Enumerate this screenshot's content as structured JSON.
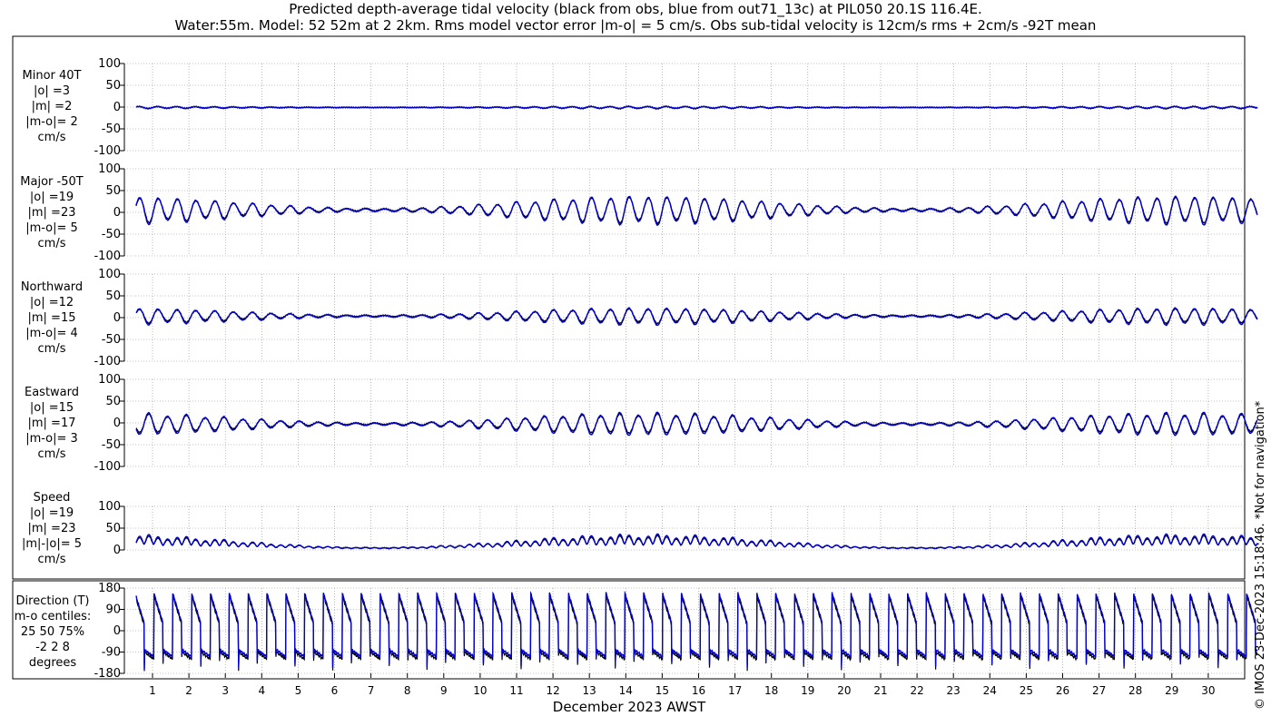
{
  "header": {
    "title_line1": "Predicted depth-average tidal velocity (black from obs, blue from out71_13c) at PIL050 20.1S 116.4E.",
    "title_line2": "Water:55m. Model: 52 52m at 2 2km. Rms model vector error |m-o| = 5 cm/s. Obs sub-tidal velocity is 12cm/s rms + 2cm/s -92T mean"
  },
  "panels": [
    {
      "lines": [
        "Minor 40T",
        "|o| =3",
        "|m| =2",
        "|m-o|= 2",
        "cm/s"
      ]
    },
    {
      "lines": [
        "Major -50T",
        "|o| =19",
        "|m| =23",
        "|m-o|= 5",
        "cm/s"
      ]
    },
    {
      "lines": [
        "Northward",
        "|o| =12",
        "|m| =15",
        "|m-o|= 4",
        "cm/s"
      ]
    },
    {
      "lines": [
        "Eastward",
        "|o| =15",
        "|m| =17",
        "|m-o|= 3",
        "cm/s"
      ]
    },
    {
      "lines": [
        "Speed",
        "|o| =19",
        "|m| =23",
        "|m|-|o|= 5",
        "cm/s"
      ]
    },
    {
      "lines": [
        "Direction (T)",
        "m-o centiles:",
        "25  50  75%",
        "-2  2  8",
        "degrees"
      ]
    }
  ],
  "xaxis": {
    "label": "December 2023 AWST"
  },
  "copyright": "© IMOS 23-Dec-2023 15:18:46. *Not for navigation*",
  "colors": {
    "obs": "#000000",
    "model": "#0000cc",
    "grid": "#888888"
  },
  "chart_data": [
    {
      "type": "line",
      "name": "Minor 40T",
      "ylim": [
        -100,
        100
      ],
      "yticks": [
        "100",
        "50",
        "0",
        "-50",
        "-100"
      ],
      "series": [
        {
          "name": "obs",
          "rms": 3
        },
        {
          "name": "model",
          "rms": 2
        }
      ]
    },
    {
      "type": "line",
      "name": "Major -50T",
      "ylim": [
        -100,
        100
      ],
      "yticks": [
        "100",
        "50",
        "0",
        "-50",
        "-100"
      ],
      "series": [
        {
          "name": "obs",
          "rms": 19
        },
        {
          "name": "model",
          "rms": 23
        }
      ]
    },
    {
      "type": "line",
      "name": "Northward",
      "ylim": [
        -100,
        100
      ],
      "yticks": [
        "100",
        "50",
        "0",
        "-50",
        "-100"
      ],
      "series": [
        {
          "name": "obs",
          "rms": 12
        },
        {
          "name": "model",
          "rms": 15
        }
      ]
    },
    {
      "type": "line",
      "name": "Eastward",
      "ylim": [
        -100,
        100
      ],
      "yticks": [
        "100",
        "50",
        "0",
        "-50",
        "-100"
      ],
      "series": [
        {
          "name": "obs",
          "rms": 15
        },
        {
          "name": "model",
          "rms": 17
        }
      ]
    },
    {
      "type": "line",
      "name": "Speed",
      "ylim": [
        0,
        100
      ],
      "yticks": [
        "100",
        "50",
        "0"
      ],
      "series": [
        {
          "name": "obs",
          "rms": 19
        },
        {
          "name": "model",
          "rms": 23
        }
      ]
    },
    {
      "type": "line",
      "name": "Direction (T)",
      "ylim": [
        -180,
        180
      ],
      "yticks": [
        "180",
        "90",
        "0",
        "-90",
        "-180"
      ],
      "series": [
        {
          "name": "obs"
        },
        {
          "name": "model"
        }
      ]
    }
  ],
  "x_ticks": [
    "1",
    "2",
    "3",
    "4",
    "5",
    "6",
    "7",
    "8",
    "9",
    "10",
    "11",
    "12",
    "13",
    "14",
    "15",
    "16",
    "17",
    "18",
    "19",
    "20",
    "21",
    "22",
    "23",
    "24",
    "25",
    "26",
    "27",
    "28",
    "29",
    "30"
  ]
}
